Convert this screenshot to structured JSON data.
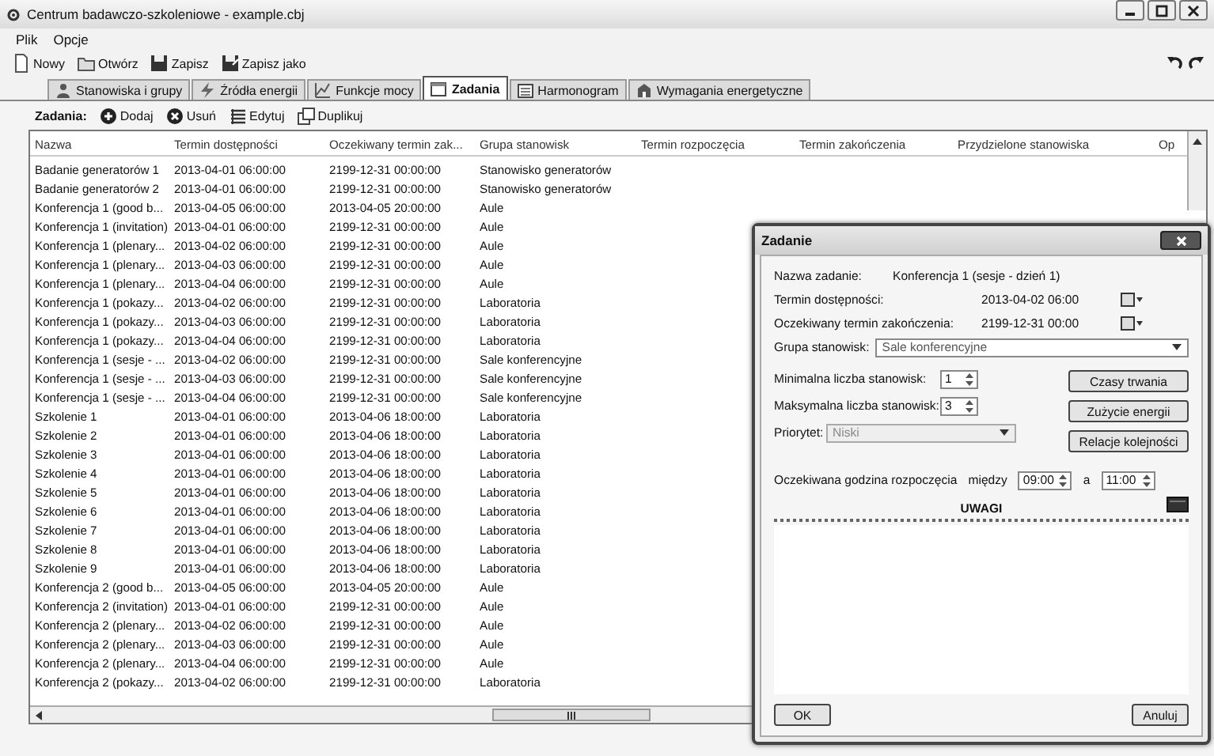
{
  "window": {
    "title": "Centrum badawczo-szkoleniowe - example.cbj"
  },
  "menu": [
    {
      "label": "Plik"
    },
    {
      "label": "Opcje"
    }
  ],
  "toolbar": [
    {
      "label": "Nowy"
    },
    {
      "label": "Otwórz"
    },
    {
      "label": "Zapisz"
    },
    {
      "label": "Zapisz jako"
    }
  ],
  "tabs": [
    {
      "label": "Stanowiska i grupy",
      "selected": false
    },
    {
      "label": "Źródła energii",
      "selected": false
    },
    {
      "label": "Funkcje mocy",
      "selected": false
    },
    {
      "label": "Zadania",
      "selected": true
    },
    {
      "label": "Harmonogram",
      "selected": false
    },
    {
      "label": "Wymagania energetyczne",
      "selected": false
    }
  ],
  "task_toolbar": {
    "label": "Zadania:",
    "buttons": [
      {
        "label": "Dodaj"
      },
      {
        "label": "Usuń"
      },
      {
        "label": "Edytuj"
      },
      {
        "label": "Duplikuj"
      }
    ]
  },
  "table": {
    "columns": [
      "Nazwa",
      "Termin dostępności",
      "Oczekiwany termin zak...",
      "Grupa stanowisk",
      "Termin rozpoczęcia",
      "Termin zakończenia",
      "Przydzielone stanowiska",
      "Op"
    ],
    "rows": [
      [
        "Badanie generatorów 1",
        "2013-04-01 06:00:00",
        "2199-12-31 00:00:00",
        "Stanowisko generatorów"
      ],
      [
        "Badanie generatorów 2",
        "2013-04-01 06:00:00",
        "2199-12-31 00:00:00",
        "Stanowisko generatorów"
      ],
      [
        "Konferencja 1 (good b...",
        "2013-04-05 06:00:00",
        "2013-04-05 20:00:00",
        "Aule"
      ],
      [
        "Konferencja 1 (invitation)",
        "2013-04-01 06:00:00",
        "2199-12-31 00:00:00",
        "Aule"
      ],
      [
        "Konferencja 1 (plenary...",
        "2013-04-02 06:00:00",
        "2199-12-31 00:00:00",
        "Aule"
      ],
      [
        "Konferencja 1 (plenary...",
        "2013-04-03 06:00:00",
        "2199-12-31 00:00:00",
        "Aule"
      ],
      [
        "Konferencja 1 (plenary...",
        "2013-04-04 06:00:00",
        "2199-12-31 00:00:00",
        "Aule"
      ],
      [
        "Konferencja 1 (pokazy...",
        "2013-04-02 06:00:00",
        "2199-12-31 00:00:00",
        "Laboratoria"
      ],
      [
        "Konferencja 1 (pokazy...",
        "2013-04-03 06:00:00",
        "2199-12-31 00:00:00",
        "Laboratoria"
      ],
      [
        "Konferencja 1 (pokazy...",
        "2013-04-04 06:00:00",
        "2199-12-31 00:00:00",
        "Laboratoria"
      ],
      [
        "Konferencja 1 (sesje - ...",
        "2013-04-02 06:00:00",
        "2199-12-31 00:00:00",
        "Sale konferencyjne"
      ],
      [
        "Konferencja 1 (sesje - ...",
        "2013-04-03 06:00:00",
        "2199-12-31 00:00:00",
        "Sale konferencyjne"
      ],
      [
        "Konferencja 1 (sesje - ...",
        "2013-04-04 06:00:00",
        "2199-12-31 00:00:00",
        "Sale konferencyjne"
      ],
      [
        "Szkolenie 1",
        "2013-04-01 06:00:00",
        "2013-04-06 18:00:00",
        "Laboratoria"
      ],
      [
        "Szkolenie 2",
        "2013-04-01 06:00:00",
        "2013-04-06 18:00:00",
        "Laboratoria"
      ],
      [
        "Szkolenie 3",
        "2013-04-01 06:00:00",
        "2013-04-06 18:00:00",
        "Laboratoria"
      ],
      [
        "Szkolenie 4",
        "2013-04-01 06:00:00",
        "2013-04-06 18:00:00",
        "Laboratoria"
      ],
      [
        "Szkolenie 5",
        "2013-04-01 06:00:00",
        "2013-04-06 18:00:00",
        "Laboratoria"
      ],
      [
        "Szkolenie 6",
        "2013-04-01 06:00:00",
        "2013-04-06 18:00:00",
        "Laboratoria"
      ],
      [
        "Szkolenie 7",
        "2013-04-01 06:00:00",
        "2013-04-06 18:00:00",
        "Laboratoria"
      ],
      [
        "Szkolenie 8",
        "2013-04-01 06:00:00",
        "2013-04-06 18:00:00",
        "Laboratoria"
      ],
      [
        "Szkolenie 9",
        "2013-04-01 06:00:00",
        "2013-04-06 18:00:00",
        "Laboratoria"
      ],
      [
        "Konferencja 2 (good b...",
        "2013-04-05 06:00:00",
        "2013-04-05 20:00:00",
        "Aule"
      ],
      [
        "Konferencja 2 (invitation)",
        "2013-04-01 06:00:00",
        "2199-12-31 00:00:00",
        "Aule"
      ],
      [
        "Konferencja 2 (plenary...",
        "2013-04-02 06:00:00",
        "2199-12-31 00:00:00",
        "Aule"
      ],
      [
        "Konferencja 2 (plenary...",
        "2013-04-03 06:00:00",
        "2199-12-31 00:00:00",
        "Aule"
      ],
      [
        "Konferencja 2 (plenary...",
        "2013-04-04 06:00:00",
        "2199-12-31 00:00:00",
        "Aule"
      ],
      [
        "Konferencja 2 (pokazy...",
        "2013-04-02 06:00:00",
        "2199-12-31 00:00:00",
        "Laboratoria"
      ]
    ]
  },
  "dialog": {
    "title": "Zadanie",
    "name": {
      "label": "Nazwa zadanie:",
      "value": "Konferencja 1 (sesje - dzień 1)"
    },
    "availability": {
      "label": "Termin dostępności:",
      "value": "2013-04-02 06:00"
    },
    "expected_end": {
      "label": "Oczekiwany termin zakończenia:",
      "value": "2199-12-31 00:00"
    },
    "group": {
      "label": "Grupa stanowisk:",
      "value": "Sale konferencyjne"
    },
    "min_stations": {
      "label": "Minimalna liczba stanowisk:",
      "value": "1"
    },
    "max_stations": {
      "label": "Maksymalna liczba stanowisk:",
      "value": "3"
    },
    "priority": {
      "label": "Priorytet:",
      "value": "Niski",
      "disabled": true
    },
    "side_buttons": [
      "Czasy trwania",
      "Zużycie energii",
      "Relacje kolejności"
    ],
    "start_time": {
      "label": "Oczekiwana godzina rozpoczęcia",
      "between": "między",
      "from": "09:00",
      "and": "a",
      "to": "11:00"
    },
    "notes": {
      "label": "UWAGI"
    },
    "ok": "OK",
    "cancel": "Anuluj"
  }
}
